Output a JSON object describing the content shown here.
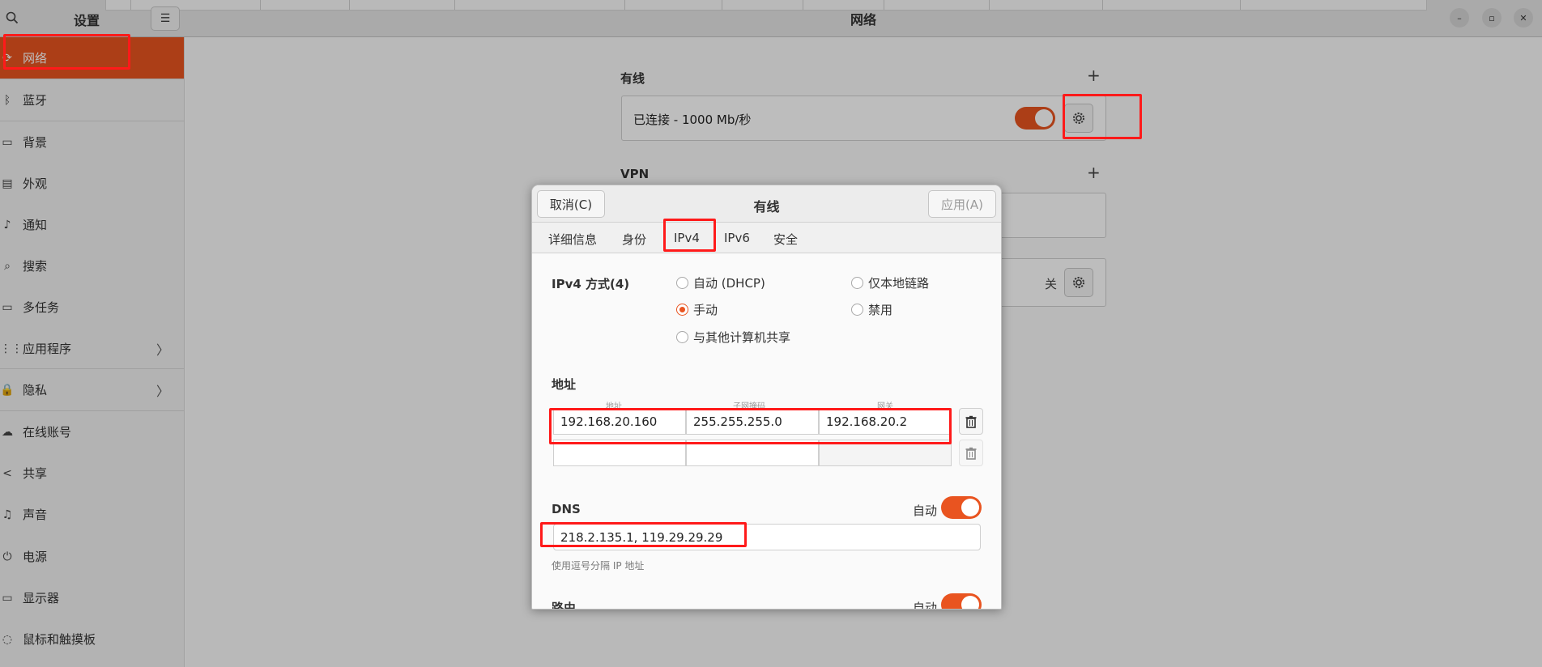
{
  "titlebar": {
    "left_title": "设置",
    "main_title": "网络"
  },
  "sidebar": {
    "items": [
      {
        "label": "网络",
        "icon": "network-icon",
        "glyph": "⟳",
        "chevron": false,
        "active": true
      },
      {
        "label": "蓝牙",
        "icon": "bluetooth-icon",
        "glyph": "ᛒ",
        "chevron": false,
        "active": false
      },
      {
        "label": "背景",
        "icon": "background-icon",
        "glyph": "▭",
        "chevron": false,
        "active": false
      },
      {
        "label": "外观",
        "icon": "appearance-icon",
        "glyph": "▤",
        "chevron": false,
        "active": false
      },
      {
        "label": "通知",
        "icon": "bell-icon",
        "glyph": "♪",
        "chevron": false,
        "active": false
      },
      {
        "label": "搜索",
        "icon": "search-icon",
        "glyph": "⌕",
        "chevron": false,
        "active": false
      },
      {
        "label": "多任务",
        "icon": "multitasking-icon",
        "glyph": "▭",
        "chevron": false,
        "active": false
      },
      {
        "label": "应用程序",
        "icon": "apps-icon",
        "glyph": "⋮⋮",
        "chevron": true,
        "active": false
      },
      {
        "label": "隐私",
        "icon": "lock-icon",
        "glyph": "🔒",
        "chevron": true,
        "active": false
      },
      {
        "label": "在线账号",
        "icon": "cloud-icon",
        "glyph": "☁",
        "chevron": false,
        "active": false
      },
      {
        "label": "共享",
        "icon": "share-icon",
        "glyph": "<",
        "chevron": false,
        "active": false
      },
      {
        "label": "声音",
        "icon": "sound-icon",
        "glyph": "♫",
        "chevron": false,
        "active": false
      },
      {
        "label": "电源",
        "icon": "power-icon",
        "glyph": "⏻",
        "chevron": false,
        "active": false
      },
      {
        "label": "显示器",
        "icon": "display-icon",
        "glyph": "▭",
        "chevron": false,
        "active": false
      },
      {
        "label": "鼠标和触摸板",
        "icon": "mouse-icon",
        "glyph": "◌",
        "chevron": false,
        "active": false
      }
    ],
    "chevron_glyph": "〉"
  },
  "main": {
    "wired_title": "有线",
    "wired_status": "已连接 - 1000 Mb/秒",
    "wired_toggle_on": true,
    "vpn_title": "VPN",
    "proxy_state": "关",
    "plus_glyph": "+"
  },
  "dialog": {
    "title": "有线",
    "cancel_label": "取消(C)",
    "apply_label": "应用(A)",
    "tabs": [
      "详细信息",
      "身份",
      "IPv4",
      "IPv6",
      "安全"
    ],
    "active_tab": "IPv4",
    "ipv4_method_label": "IPv4 方式(4)",
    "methods": {
      "auto_dhcp": "自动 (DHCP)",
      "link_local": "仅本地链路",
      "manual": "手动",
      "disabled": "禁用",
      "shared": "与其他计算机共享"
    },
    "selected_method": "手动",
    "address_section": "地址",
    "col_address": "地址",
    "col_netmask": "子网掩码",
    "col_gateway": "网关",
    "address_rows": [
      {
        "address": "192.168.20.160",
        "netmask": "255.255.255.0",
        "gateway": "192.168.20.2"
      },
      {
        "address": "",
        "netmask": "",
        "gateway": ""
      }
    ],
    "dns_label": "DNS",
    "dns_auto_label": "自动",
    "dns_value": "218.2.135.1, 119.29.29.29",
    "dns_hint": "使用逗号分隔 IP 地址",
    "routes_label": "路由",
    "routes_auto_label": "自动"
  },
  "colors": {
    "accent": "#e95420",
    "annotation": "#ff1a1a"
  }
}
